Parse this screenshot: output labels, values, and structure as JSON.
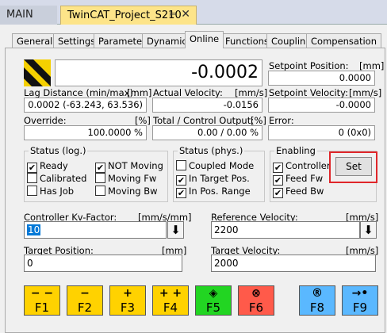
{
  "doc_tabs": {
    "main": "MAIN",
    "project": "TwinCAT_Project_S210",
    "pin": "⊨",
    "close": "✕"
  },
  "tabs": [
    "General",
    "Settings",
    "Parameter",
    "Dynamics",
    "Online",
    "Functions",
    "Coupling",
    "Compensation"
  ],
  "online": {
    "actual_position": "-0.0002",
    "setpoint_position": {
      "label": "Setpoint Position:",
      "unit": "[mm]",
      "value": "0.0000"
    },
    "lag_distance": {
      "label": "Lag Distance (min/max):",
      "unit": "[mm]",
      "value": "0.0002  (-63.243, 63.536)"
    },
    "actual_velocity": {
      "label": "Actual Velocity:",
      "unit": "[mm/s]",
      "value": "-0.0156"
    },
    "setpoint_velocity": {
      "label": "Setpoint Velocity:",
      "unit": "[mm/s]",
      "value": "-0.0000"
    },
    "override": {
      "label": "Override:",
      "unit": "[%]",
      "value": "100.0000 %"
    },
    "control_output": {
      "label": "Total / Control Output:",
      "unit": "[%]",
      "value": "0.00 /  0.00 %"
    },
    "error": {
      "label": "Error:",
      "value": "0 (0x0)"
    }
  },
  "status_log": {
    "title": "Status (log.)",
    "items": [
      {
        "label": "Ready",
        "checked": true
      },
      {
        "label": "Calibrated",
        "checked": false
      },
      {
        "label": "Has Job",
        "checked": false
      },
      {
        "label": "NOT Moving",
        "checked": true
      },
      {
        "label": "Moving Fw",
        "checked": false
      },
      {
        "label": "Moving Bw",
        "checked": false
      }
    ]
  },
  "status_phys": {
    "title": "Status (phys.)",
    "items": [
      {
        "label": "Coupled Mode",
        "checked": false
      },
      {
        "label": "In Target Pos.",
        "checked": true
      },
      {
        "label": "In Pos. Range",
        "checked": true
      }
    ]
  },
  "enabling": {
    "title": "Enabling",
    "items": [
      {
        "label": "Controller",
        "checked": true
      },
      {
        "label": "Feed Fw",
        "checked": true
      },
      {
        "label": "Feed Bw",
        "checked": true
      }
    ],
    "set_label": "Set"
  },
  "kv_factor": {
    "label": "Controller Kv-Factor:",
    "unit": "[mm/s/mm]",
    "value": "10"
  },
  "reference_velocity": {
    "label": "Reference Velocity:",
    "unit": "[mm/s]",
    "value": "2200"
  },
  "target_position": {
    "label": "Target Position:",
    "unit": "[mm]",
    "value": "0"
  },
  "target_velocity": {
    "label": "Target Velocity:",
    "unit": "[mm/s]",
    "value": "2000"
  },
  "fkeys": [
    {
      "label": "F1",
      "symbol": "− −",
      "color": "#ffd200"
    },
    {
      "label": "F2",
      "symbol": "−",
      "color": "#ffd200"
    },
    {
      "label": "F3",
      "symbol": "+",
      "color": "#ffd200"
    },
    {
      "label": "F4",
      "symbol": "+ +",
      "color": "#ffd200"
    },
    {
      "label": "F5",
      "symbol": "◈",
      "color": "#22d522"
    },
    {
      "label": "F6",
      "symbol": "⊗",
      "color": "#ff5a4a"
    },
    {
      "label": "F8",
      "symbol": "®",
      "color": "#5ab8ff"
    },
    {
      "label": "F9",
      "symbol": "→•",
      "color": "#5ab8ff"
    }
  ],
  "check_mark": "✔",
  "arrow_down": "⬇"
}
